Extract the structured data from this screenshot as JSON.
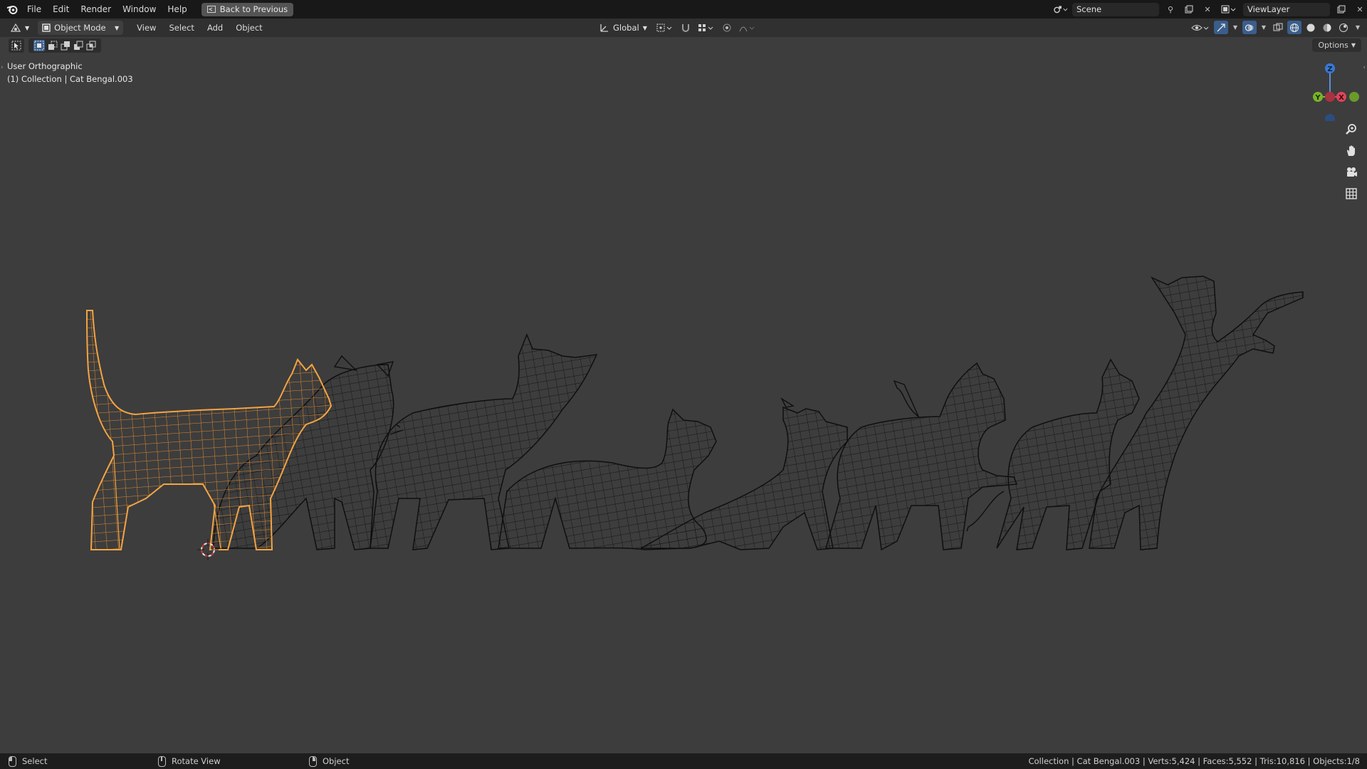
{
  "menubar": {
    "items": [
      "File",
      "Edit",
      "Render",
      "Window",
      "Help"
    ],
    "back_button": "Back to Previous",
    "scene": "Scene",
    "view_layer": "ViewLayer"
  },
  "header": {
    "mode": "Object Mode",
    "menus": [
      "View",
      "Select",
      "Add",
      "Object"
    ],
    "orientation": "Global",
    "options": "Options"
  },
  "viewport": {
    "view_name": "User Orthographic",
    "collection_info": "(1) Collection | Cat Bengal.003",
    "gizmo_axes": [
      "Z",
      "Y",
      "X"
    ],
    "colors": {
      "selected": "#f5a442",
      "wire": "#0f0f0f",
      "background": "#3d3d3d"
    }
  },
  "statusbar": {
    "left_click": "Select",
    "middle_click": "Rotate View",
    "right_click": "Object",
    "stats": "Collection | Cat Bengal.003 | Verts:5,424 | Faces:5,552 | Tris:10,816 | Objects:1/8"
  }
}
